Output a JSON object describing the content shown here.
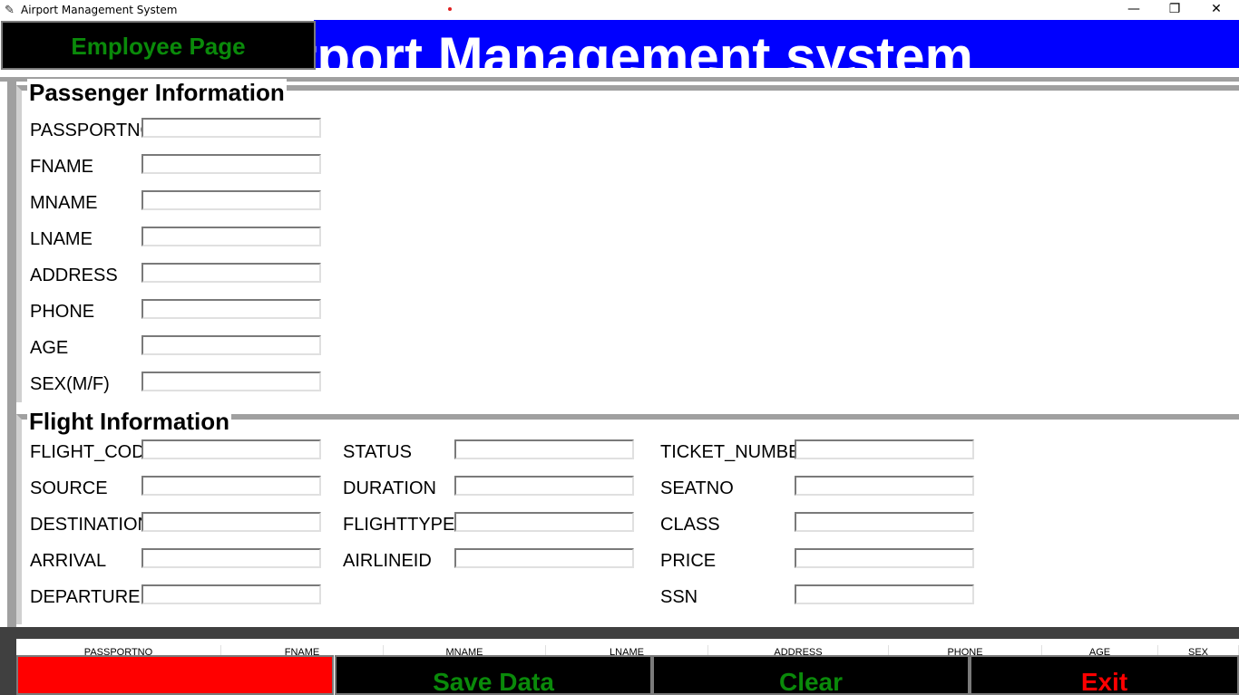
{
  "window": {
    "title": "Airport Management System",
    "minimize": "—",
    "maximize": "❐",
    "close": "✕"
  },
  "header": {
    "banner_text": "Airport Management system",
    "employee_button": "Employee Page",
    "banner_color": "#0000ff"
  },
  "passenger": {
    "title": "Passenger Information",
    "fields": [
      {
        "label": "PASSPORTNO",
        "value": ""
      },
      {
        "label": "FNAME",
        "value": ""
      },
      {
        "label": "MNAME",
        "value": ""
      },
      {
        "label": "LNAME",
        "value": ""
      },
      {
        "label": "ADDRESS",
        "value": ""
      },
      {
        "label": "PHONE",
        "value": ""
      },
      {
        "label": "AGE",
        "value": ""
      },
      {
        "label": "SEX(M/F)",
        "value": ""
      }
    ]
  },
  "flight": {
    "title": "Flight Information",
    "col1": [
      {
        "label": "FLIGHT_CODE",
        "value": ""
      },
      {
        "label": "SOURCE",
        "value": ""
      },
      {
        "label": "DESTINATION",
        "value": ""
      },
      {
        "label": "ARRIVAL",
        "value": ""
      },
      {
        "label": "DEPARTURE",
        "value": ""
      }
    ],
    "col2": [
      {
        "label": "STATUS",
        "value": ""
      },
      {
        "label": "DURATION",
        "value": ""
      },
      {
        "label": "FLIGHTTYPE",
        "value": ""
      },
      {
        "label": "AIRLINEID",
        "value": ""
      }
    ],
    "col3": [
      {
        "label": "TICKET_NUMBER",
        "value": ""
      },
      {
        "label": "SEATNO",
        "value": ""
      },
      {
        "label": "CLASS",
        "value": ""
      },
      {
        "label": "PRICE",
        "value": ""
      },
      {
        "label": "SSN",
        "value": ""
      }
    ]
  },
  "table": {
    "columns": [
      "PASSPORTNO",
      "FNAME",
      "MNAME",
      "LNAME",
      "ADDRESS",
      "PHONE",
      "AGE",
      "SEX"
    ]
  },
  "buttons": {
    "first": "",
    "save": "Save Data",
    "clear": "Clear",
    "exit": "Exit"
  }
}
